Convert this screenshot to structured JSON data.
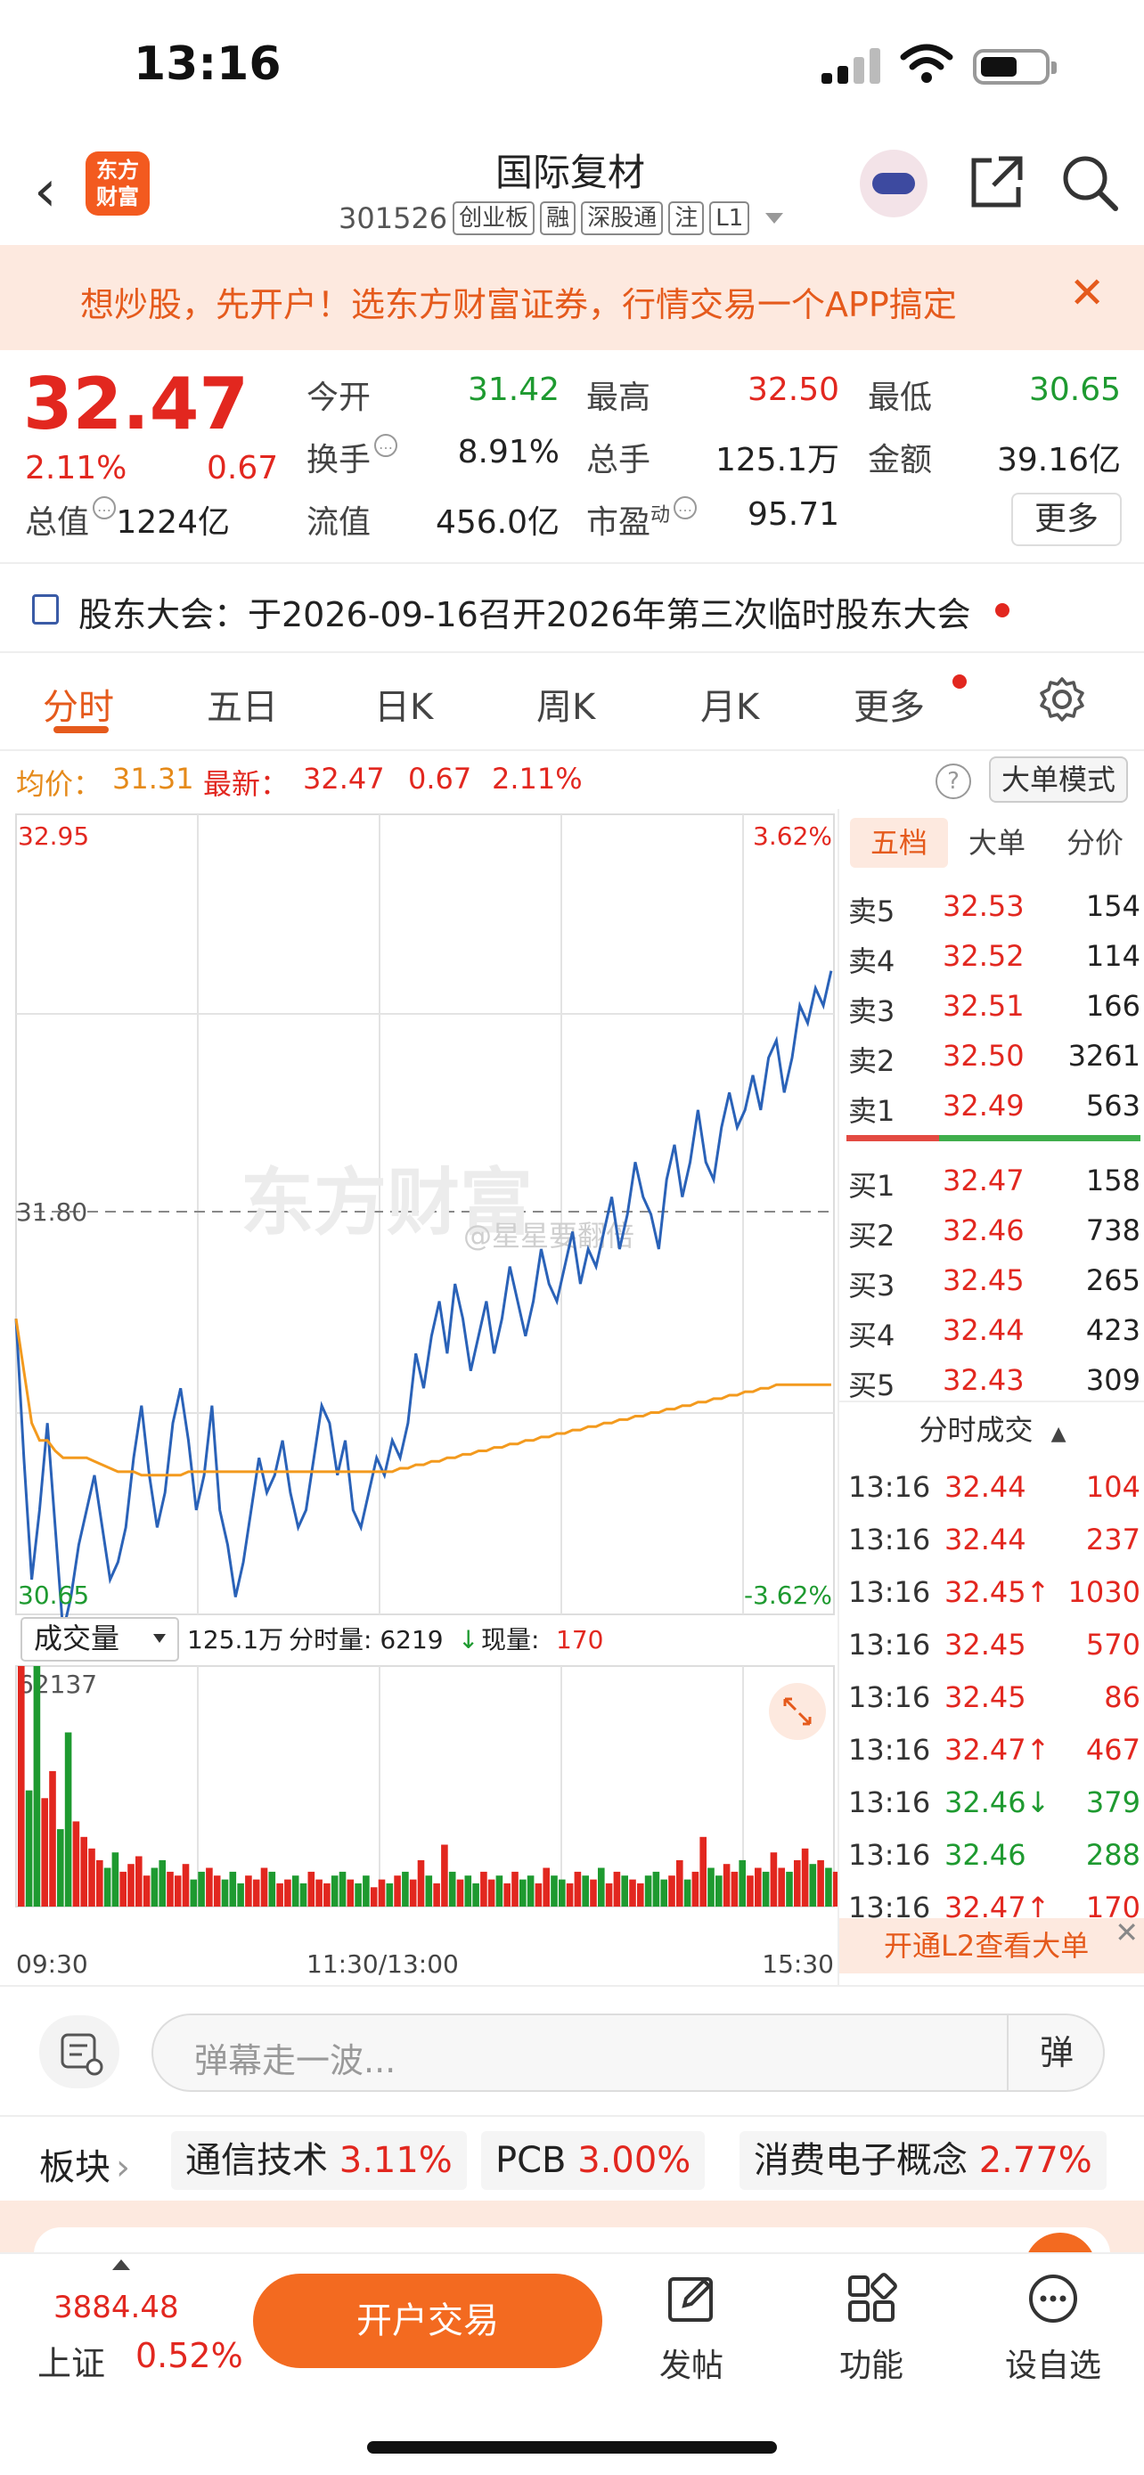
{
  "status_bar": {
    "time": "13:16"
  },
  "header": {
    "brand_logo": "东方\n财富",
    "stock_name": "国际复材",
    "stock_code": "301526",
    "tags": [
      "创业板",
      "融",
      "深股通",
      "注",
      "L1"
    ]
  },
  "promo": {
    "text": "想炒股，先开户！选东方财富证券，行情交易一个APP搞定",
    "close": "✕"
  },
  "quote": {
    "price": "32.47",
    "change_pct": "2.11%",
    "change": "0.67",
    "fields": [
      {
        "label": "今开",
        "value": "31.42",
        "color": "#1e9a30"
      },
      {
        "label": "最高",
        "value": "32.50",
        "color": "#e2271f"
      },
      {
        "label": "最低",
        "value": "30.65",
        "color": "#1e9a30"
      },
      {
        "label": "换手",
        "value": "8.91%",
        "color": "#222"
      },
      {
        "label": "总手",
        "value": "125.1万",
        "color": "#222"
      },
      {
        "label": "金额",
        "value": "39.16亿",
        "color": "#222"
      },
      {
        "label": "总值",
        "value": "1224亿",
        "color": "#222"
      },
      {
        "label": "流值",
        "value": "456.0亿",
        "color": "#222"
      },
      {
        "label": "市盈",
        "value": "95.71",
        "color": "#222"
      }
    ],
    "pe_sup": "动",
    "more": "更多"
  },
  "notice": {
    "text": "股东大会：于2026-09-16召开2026年第三次临时股东大会"
  },
  "tabs": [
    "分时",
    "五日",
    "日K",
    "周K",
    "月K",
    "更多"
  ],
  "summary": {
    "avg_label": "均价：",
    "avg_value": "31.31",
    "latest_label": "最新：",
    "latest_value": "32.47",
    "change": "0.67",
    "change_pct": "2.11%",
    "help": "?",
    "mode_button": "大单模式"
  },
  "chart_data": {
    "type": "line",
    "price_axis": {
      "max": "32.95",
      "mid": "31.80",
      "min": "30.65",
      "pct_max": "3.62%",
      "pct_min": "-3.62%"
    },
    "ylim": [
      30.65,
      32.95
    ],
    "watermark_brand": "东方财富",
    "watermark_user": "@星星要翻倍",
    "x_labels": [
      "09:30",
      "11:30/13:00",
      "15:30"
    ],
    "series": [
      {
        "color": "#2a62b8",
        "values": [
          31.5,
          31.1,
          30.75,
          30.95,
          31.2,
          30.9,
          30.6,
          30.7,
          30.85,
          30.95,
          31.05,
          30.9,
          30.75,
          30.8,
          30.9,
          31.1,
          31.25,
          31.05,
          30.9,
          31.0,
          31.2,
          31.3,
          31.15,
          30.95,
          31.05,
          31.25,
          30.95,
          30.85,
          30.7,
          30.8,
          30.95,
          31.1,
          31.0,
          31.05,
          31.15,
          31.0,
          30.9,
          30.95,
          31.1,
          31.25,
          31.2,
          31.05,
          31.15,
          30.95,
          30.9,
          31.0,
          31.1,
          31.05,
          31.15,
          31.1,
          31.2,
          31.4,
          31.3,
          31.45,
          31.55,
          31.4,
          31.6,
          31.5,
          31.35,
          31.45,
          31.55,
          31.4,
          31.5,
          31.65,
          31.55,
          31.45,
          31.55,
          31.7,
          31.6,
          31.55,
          31.65,
          31.75,
          31.6,
          31.7,
          31.65,
          31.75,
          31.85,
          31.7,
          31.8,
          31.95,
          31.85,
          31.8,
          31.7,
          31.9,
          32.0,
          31.85,
          31.95,
          32.1,
          31.95,
          31.9,
          32.05,
          32.15,
          32.05,
          32.1,
          32.2,
          32.1,
          32.25,
          32.3,
          32.15,
          32.25,
          32.4,
          32.35,
          32.45,
          32.4,
          32.5
        ]
      },
      {
        "color": "#f39a1e",
        "values": [
          31.5,
          31.35,
          31.2,
          31.15,
          31.15,
          31.12,
          31.1,
          31.1,
          31.1,
          31.1,
          31.09,
          31.08,
          31.07,
          31.06,
          31.06,
          31.06,
          31.05,
          31.05,
          31.05,
          31.05,
          31.05,
          31.05,
          31.06,
          31.06,
          31.06,
          31.06,
          31.06,
          31.06,
          31.06,
          31.06,
          31.06,
          31.06,
          31.06,
          31.06,
          31.06,
          31.06,
          31.06,
          31.06,
          31.06,
          31.06,
          31.06,
          31.06,
          31.06,
          31.06,
          31.06,
          31.06,
          31.06,
          31.06,
          31.06,
          31.07,
          31.07,
          31.08,
          31.08,
          31.09,
          31.09,
          31.1,
          31.1,
          31.11,
          31.11,
          31.12,
          31.12,
          31.13,
          31.13,
          31.14,
          31.14,
          31.15,
          31.15,
          31.16,
          31.16,
          31.17,
          31.17,
          31.18,
          31.18,
          31.19,
          31.19,
          31.2,
          31.2,
          31.21,
          31.21,
          31.22,
          31.22,
          31.23,
          31.23,
          31.24,
          31.24,
          31.25,
          31.25,
          31.26,
          31.26,
          31.27,
          31.27,
          31.28,
          31.28,
          31.29,
          31.29,
          31.3,
          31.3,
          31.31,
          31.31,
          31.31,
          31.31,
          31.31,
          31.31,
          31.31,
          31.31
        ]
      }
    ],
    "volume": {
      "label": "成交量",
      "total": "125.1万",
      "period_label": "分时量: 6219",
      "now_label": "现量:",
      "now_value": "170",
      "max_label": "62137",
      "ylim": [
        0,
        62137
      ],
      "bars": [
        62137,
        30000,
        62137,
        28000,
        35000,
        20000,
        45000,
        22000,
        18000,
        15000,
        12000,
        10000,
        14000,
        9000,
        11000,
        13000,
        8000,
        10000,
        12000,
        9000,
        8000,
        11000,
        7000,
        9000,
        10000,
        8000,
        7000,
        9000,
        6000,
        8000,
        7000,
        10000,
        9000,
        6000,
        7000,
        8000,
        6000,
        9000,
        7000,
        6000,
        8000,
        9000,
        7000,
        6000,
        8000,
        5000,
        7000,
        6000,
        8000,
        9000,
        7000,
        12000,
        8000,
        6000,
        16000,
        9000,
        7000,
        8000,
        6000,
        9000,
        7000,
        8000,
        6000,
        9000,
        7000,
        8000,
        6000,
        10000,
        8000,
        7000,
        6000,
        9000,
        8000,
        7000,
        10000,
        6000,
        9000,
        8000,
        7000,
        6000,
        8000,
        9000,
        7000,
        8000,
        12000,
        7000,
        9000,
        18000,
        10000,
        8000,
        11000,
        9000,
        12000,
        8000,
        10000,
        9000,
        14000,
        10000,
        9000,
        12000,
        15000,
        11000,
        12000,
        10000,
        9000
      ]
    }
  },
  "orderbook": {
    "tabs": [
      "五档",
      "大单",
      "分价"
    ],
    "sells": [
      {
        "label": "卖5",
        "price": "32.53",
        "vol": "154"
      },
      {
        "label": "卖4",
        "price": "32.52",
        "vol": "114"
      },
      {
        "label": "卖3",
        "price": "32.51",
        "vol": "166"
      },
      {
        "label": "卖2",
        "price": "32.50",
        "vol": "3261"
      },
      {
        "label": "卖1",
        "price": "32.49",
        "vol": "563"
      }
    ],
    "buys": [
      {
        "label": "买1",
        "price": "32.47",
        "vol": "158"
      },
      {
        "label": "买2",
        "price": "32.46",
        "vol": "738"
      },
      {
        "label": "买3",
        "price": "32.45",
        "vol": "265"
      },
      {
        "label": "买4",
        "price": "32.44",
        "vol": "423"
      },
      {
        "label": "买5",
        "price": "32.43",
        "vol": "309"
      }
    ],
    "trades_title": "分时成交",
    "trades": [
      {
        "time": "13:16",
        "price": "32.44",
        "vol": "104",
        "dir": "",
        "color": "#e2271f"
      },
      {
        "time": "13:16",
        "price": "32.44",
        "vol": "237",
        "dir": "",
        "color": "#e2271f"
      },
      {
        "time": "13:16",
        "price": "32.45↑",
        "vol": "1030",
        "dir": "up",
        "color": "#e2271f"
      },
      {
        "time": "13:16",
        "price": "32.45",
        "vol": "570",
        "dir": "",
        "color": "#e2271f"
      },
      {
        "time": "13:16",
        "price": "32.45",
        "vol": "86",
        "dir": "",
        "color": "#e2271f"
      },
      {
        "time": "13:16",
        "price": "32.47↑",
        "vol": "467",
        "dir": "up",
        "color": "#e2271f"
      },
      {
        "time": "13:16",
        "price": "32.46↓",
        "vol": "379",
        "dir": "down",
        "color": "#1e9a30"
      },
      {
        "time": "13:16",
        "price": "32.46",
        "vol": "288",
        "dir": "",
        "color": "#1e9a30"
      },
      {
        "time": "13:16",
        "price": "32.47↑",
        "vol": "170",
        "dir": "up",
        "color": "#e2271f"
      }
    ],
    "l2_text": "开通L2查看大单"
  },
  "danmu": {
    "placeholder": "弹幕走一波...",
    "button": "弹"
  },
  "sectors": {
    "label": "板块",
    "items": [
      {
        "name": "通信技术",
        "pct": "3.11%"
      },
      {
        "name": "PCB",
        "pct": "3.00%"
      },
      {
        "name": "消费电子概念",
        "pct": "2.77%"
      }
    ]
  },
  "bottom_bar": {
    "index_value": "3884.48",
    "index_name": "上证",
    "index_pct": "0.52%",
    "trade_button": "开户交易",
    "nav": [
      {
        "label": "发帖",
        "icon": "edit-icon"
      },
      {
        "label": "功能",
        "icon": "grid-icon"
      },
      {
        "label": "设自选",
        "icon": "more-dots-icon"
      }
    ]
  }
}
